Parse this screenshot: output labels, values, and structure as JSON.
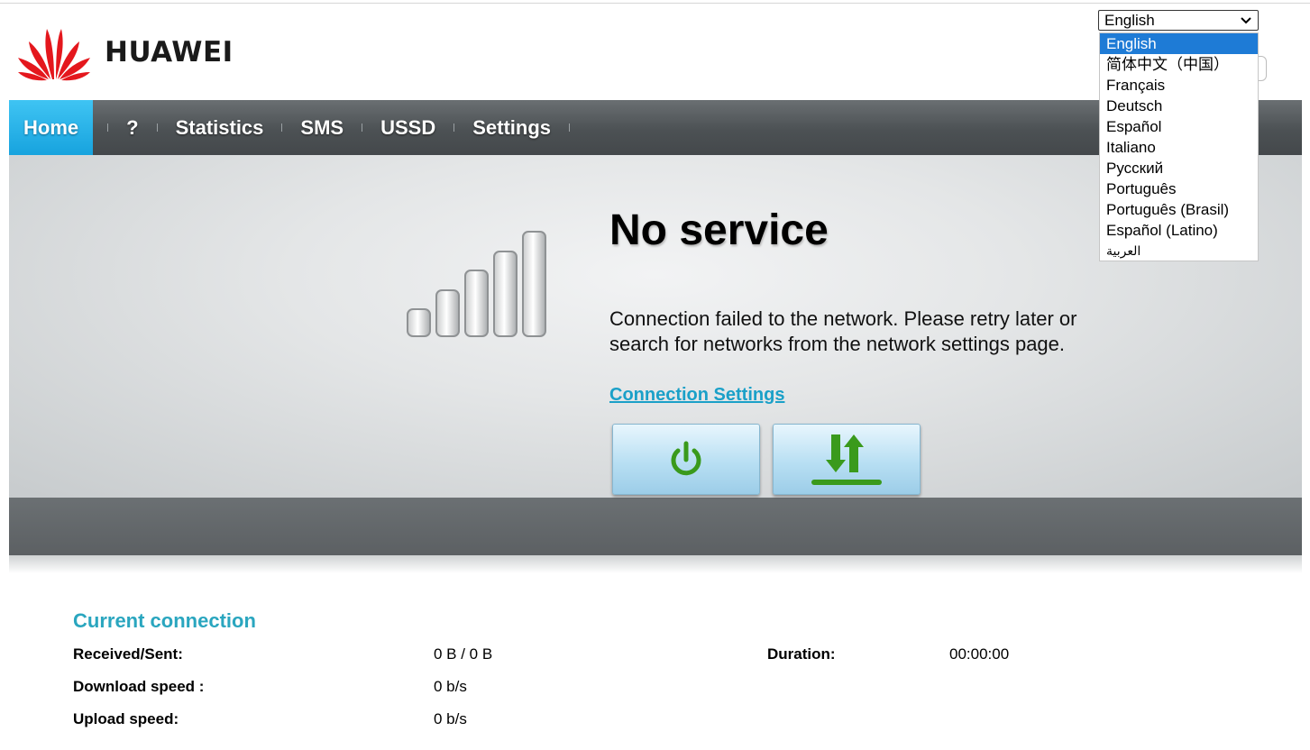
{
  "header": {
    "brand": "HUAWEI",
    "language": {
      "selected": "English",
      "options": [
        "English",
        "简体中文（中国）",
        "Français",
        "Deutsch",
        "Español",
        "Italiano",
        "Русский",
        "Português",
        "Português (Brasil)",
        "Español (Latino)",
        "العربية"
      ]
    }
  },
  "nav": {
    "items": [
      "Home",
      "?",
      "Statistics",
      "SMS",
      "USSD",
      "Settings"
    ],
    "active": "Home"
  },
  "status": {
    "title": "No service",
    "message": "Connection failed to the network. Please retry later or search for networks from the network settings page.",
    "link": "Connection Settings",
    "signal_bars": 5,
    "signal_level": 0
  },
  "buttons": {
    "power_icon": "power-icon",
    "data_icon": "up-down-arrows-icon"
  },
  "connection": {
    "title": "Current connection",
    "received_sent_label": "Received/Sent:",
    "received_sent_value": "0 B /  0 B",
    "duration_label": "Duration:",
    "duration_value": "00:00:00",
    "download_label": "Download speed :",
    "download_value": "0 b/s",
    "upload_label": "Upload speed:",
    "upload_value": "0 b/s"
  },
  "colors": {
    "accent_blue": "#1aa3dd",
    "link": "#1aa0c8",
    "section_title": "#2aa6bf",
    "brand_red": "#e4171d",
    "icon_green": "#3a9a1c",
    "selection": "#1e7bd6"
  }
}
